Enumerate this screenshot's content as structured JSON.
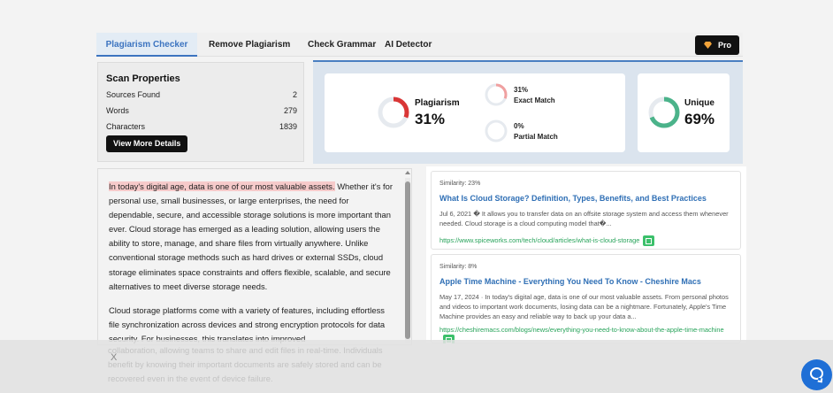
{
  "tabs": [
    {
      "label": "Plagiarism Checker",
      "active": true
    },
    {
      "label": "Remove Plagiarism",
      "active": false
    },
    {
      "label": "Check Grammar",
      "active": false
    },
    {
      "label": "AI Detector",
      "active": false
    }
  ],
  "pro_label": "Pro",
  "scan": {
    "title": "Scan Properties",
    "rows": [
      {
        "label": "Sources Found",
        "value": "2"
      },
      {
        "label": "Words",
        "value": "279"
      },
      {
        "label": "Characters",
        "value": "1839"
      }
    ],
    "button": "View More Details"
  },
  "results": {
    "plagiarism_label": "Plagiarism",
    "plagiarism_pct": "31%",
    "plagiarism_fraction": 0.31,
    "exact_pct": "31%",
    "exact_label": "Exact Match",
    "partial_pct": "0%",
    "partial_label": "Partial Match",
    "unique_label": "Unique",
    "unique_pct": "69%",
    "unique_fraction": 0.69,
    "colors": {
      "plagiarism": "#d93636",
      "unique": "#4bb38a",
      "track": "#e6eaef"
    }
  },
  "text": {
    "highlight": "In today's digital age, data is one of our most valuable assets.",
    "para1_rest": " Whether it's for personal use, small businesses, or large enterprises, the need for dependable, secure, and accessible storage solutions is more important than ever. Cloud storage has emerged as a leading solution, allowing users the ability to store, manage, and share files from virtually anywhere. Unlike conventional storage methods such as hard drives or external SSDs, cloud storage eliminates space constraints and offers flexible, scalable, and secure alternatives to meet diverse storage needs.",
    "para2": "Cloud storage platforms come with a variety of features, including effortless file synchronization across devices and strong encryption protocols for data security. For businesses, this translates into improved",
    "overlay": "collaboration, allowing teams to share and edit files in real-time. Individuals benefit by knowing their important documents are safely stored and can be recovered even in the event of device failure."
  },
  "sources": [
    {
      "similarity": "Similarity: 23%",
      "title": "What Is Cloud Storage? Definition, Types, Benefits, and Best Practices",
      "desc": "Jul 6, 2021 � It allows you to transfer data on an offsite storage system and access them whenever needed. Cloud storage is a cloud computing model that�...",
      "url": "https://www.spiceworks.com/tech/cloud/articles/what-is-cloud-storage"
    },
    {
      "similarity": "Similarity: 8%",
      "title": "Apple Time Machine - Everything You Need To Know - Cheshire Macs",
      "desc": "May 17, 2024 · In today's digital age, data is one of our most valuable assets. From personal photos and videos to important work documents, losing data can be a nightmare. Fortunately, Apple's Time Machine provides an easy and reliable way to back up your data a...",
      "url": "https://cheshiremacs.com/blogs/news/everything-you-need-to-know-about-the-apple-time-machine"
    }
  ],
  "close_label": "X"
}
